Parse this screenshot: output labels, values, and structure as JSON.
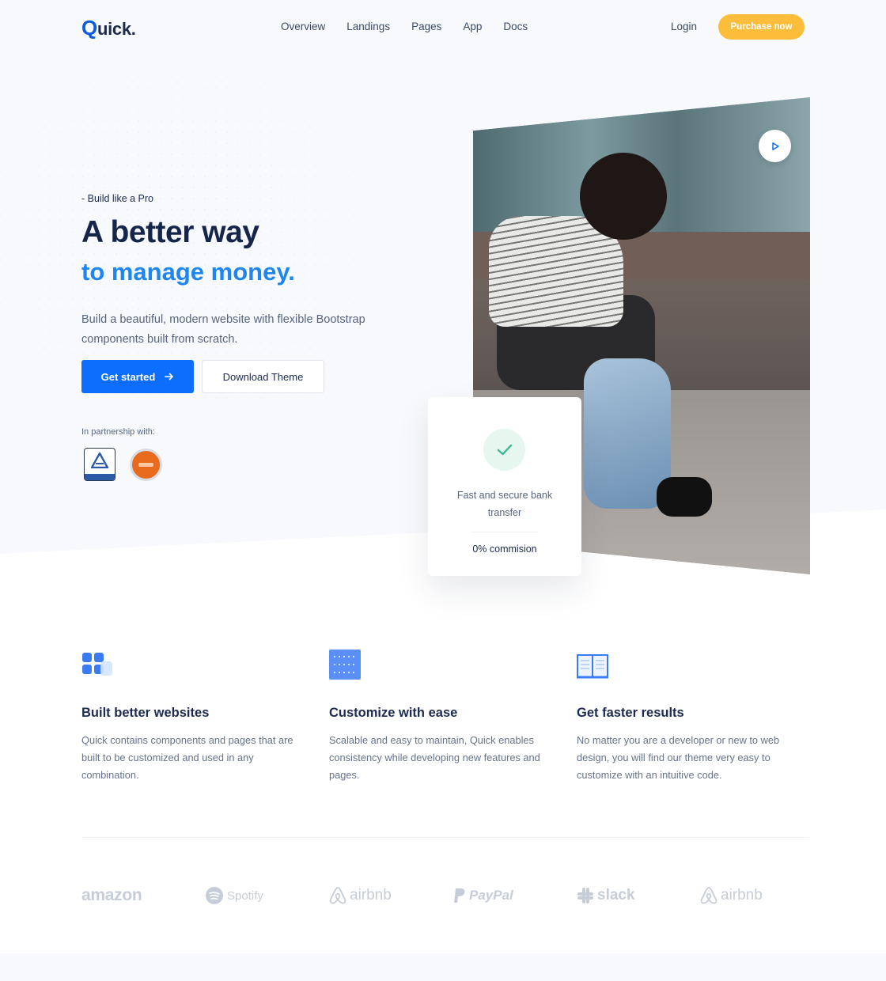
{
  "nav": {
    "logo_q": "Q",
    "logo_rest": "uick.",
    "links": [
      "Overview",
      "Landings",
      "Pages",
      "App",
      "Docs"
    ],
    "login": "Login",
    "purchase": "Purchase now"
  },
  "hero": {
    "eyebrow": "- Build like a Pro",
    "title_line1": "A better way",
    "title_line2": "to manage money.",
    "lead": "Build a beautiful, modern website with flexible Bootstrap components built from scratch.",
    "cta_primary": "Get started",
    "cta_secondary": "Download Theme",
    "partner_label": "In partnership with:"
  },
  "card": {
    "text": "Fast and secure bank transfer",
    "footer": "0% commision"
  },
  "features": [
    {
      "title": "Built better websites",
      "text": "Quick contains components and pages that are built to be customized and used in any combination."
    },
    {
      "title": "Customize with ease",
      "text": "Scalable and easy to maintain, Quick enables consistency while developing new features and pages."
    },
    {
      "title": "Get faster results",
      "text": "No matter you are a developer or new to web design, you will find our theme very easy to customize with an intuitive code."
    }
  ],
  "brands": [
    "amazon",
    "Spotify",
    "airbnb",
    "PayPal",
    "slack",
    "airbnb"
  ],
  "colors": {
    "primary": "#0d6efd",
    "accent": "#fbbd3a",
    "heading": "#1b2a4e",
    "highlight": "#1d86f0"
  }
}
